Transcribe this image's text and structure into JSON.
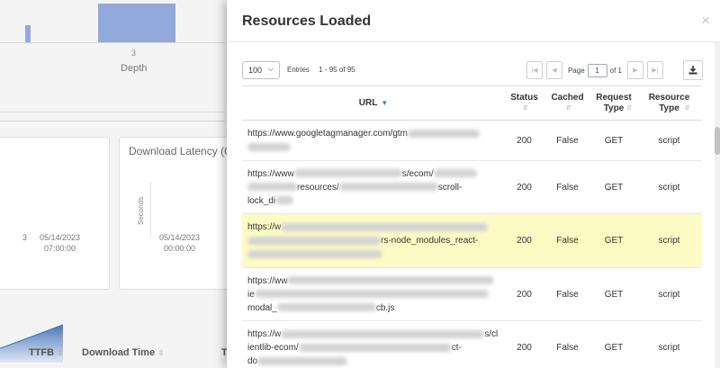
{
  "background": {
    "depth_tick": "3",
    "depth_label": "Depth",
    "latency_card_title": "Download Latency (C",
    "latency_yaxis_label": "Seconds",
    "left_xtick": {
      "date": "05/14/2023",
      "time": "07:00:00"
    },
    "left_xtick_stub": "3",
    "latency_xtick": {
      "date": "05/14/2023",
      "time": "00:00:00"
    },
    "columns": [
      "TTFB",
      "Download Time",
      "T"
    ],
    "colors": {
      "bar": "#93a9dc",
      "area": "#5b84c4"
    }
  },
  "modal": {
    "title": "Resources Loaded",
    "close": "×",
    "toolbar": {
      "per_page": "100",
      "entries_label": "Entries",
      "range": "1 - 95 of 95",
      "page_label": "Page",
      "current_page": "1",
      "of_label": "of 1"
    },
    "columns": {
      "url": "URL",
      "status": "Status",
      "cached": "Cached",
      "request_type": "Request Type",
      "resource_type": "Resource Type"
    },
    "rows": [
      {
        "url_a": "https://www.googletagmanager.com/gtm",
        "url_b": "",
        "url_c": "",
        "status": "200",
        "cached": "False",
        "request_type": "GET",
        "resource_type": "script"
      },
      {
        "url_a": "https://www",
        "url_b": "s/ecom/",
        "url_c": "resources/",
        "url_d": "scroll-",
        "url_e": "lock_di",
        "status": "200",
        "cached": "False",
        "request_type": "GET",
        "resource_type": "script"
      },
      {
        "url_a": "https://w",
        "url_b": "rs-node_modules_react-",
        "status": "200",
        "cached": "False",
        "request_type": "GET",
        "resource_type": "script"
      },
      {
        "url_a": "https://ww",
        "url_b": "ie",
        "url_c": "modal_",
        "url_d": "cb.js",
        "status": "200",
        "cached": "False",
        "request_type": "GET",
        "resource_type": "script"
      },
      {
        "url_a": "https://w",
        "url_b": "s/cl",
        "url_c": "ientlib-ecom/",
        "url_d": "ct-",
        "url_e": "do",
        "status": "200",
        "cached": "False",
        "request_type": "GET",
        "resource_type": "script"
      }
    ]
  }
}
